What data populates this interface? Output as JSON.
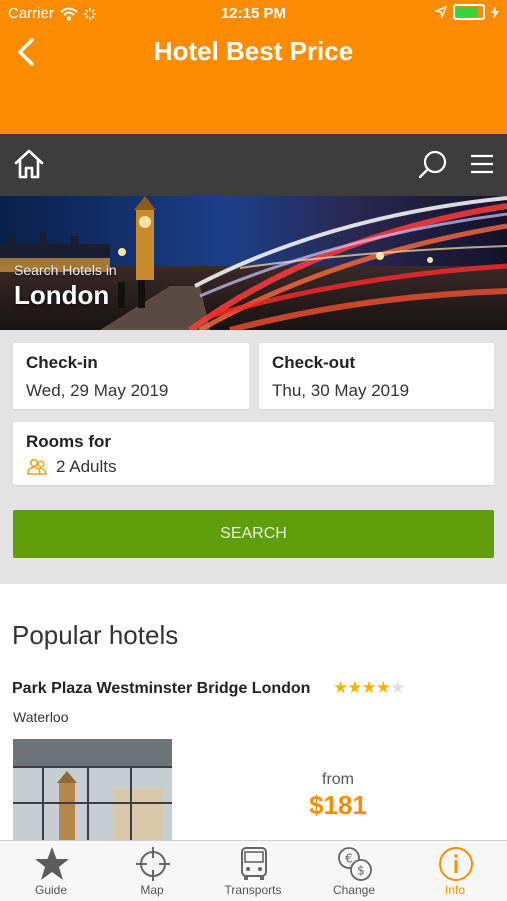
{
  "status": {
    "carrier": "Carrier",
    "time": "12:15 PM"
  },
  "appbar": {
    "title": "Hotel Best Price"
  },
  "hero": {
    "subtitle": "Search Hotels in",
    "city": "London"
  },
  "form": {
    "checkin_label": "Check-in",
    "checkin_value": "Wed, 29 May 2019",
    "checkout_label": "Check-out",
    "checkout_value": "Thu, 30 May 2019",
    "rooms_label": "Rooms for",
    "rooms_value": "2 Adults",
    "search_label": "SEARCH"
  },
  "popular": {
    "heading": "Popular hotels",
    "hotel": {
      "name": "Park Plaza Westminster Bridge London",
      "stars": 4,
      "max_stars": 5,
      "area": "Waterloo",
      "from_label": "from",
      "price": "$181"
    }
  },
  "tabs": [
    {
      "label": "Guide",
      "icon": "star-icon"
    },
    {
      "label": "Map",
      "icon": "crosshair-icon"
    },
    {
      "label": "Transports",
      "icon": "bus-icon"
    },
    {
      "label": "Change",
      "icon": "currency-exchange-icon"
    },
    {
      "label": "Info",
      "icon": "info-icon",
      "active": true
    }
  ],
  "colors": {
    "accent": "#fb8c00",
    "search_button": "#5f9d0b",
    "navbar": "#3d3d3d",
    "star": "#f5b400"
  }
}
